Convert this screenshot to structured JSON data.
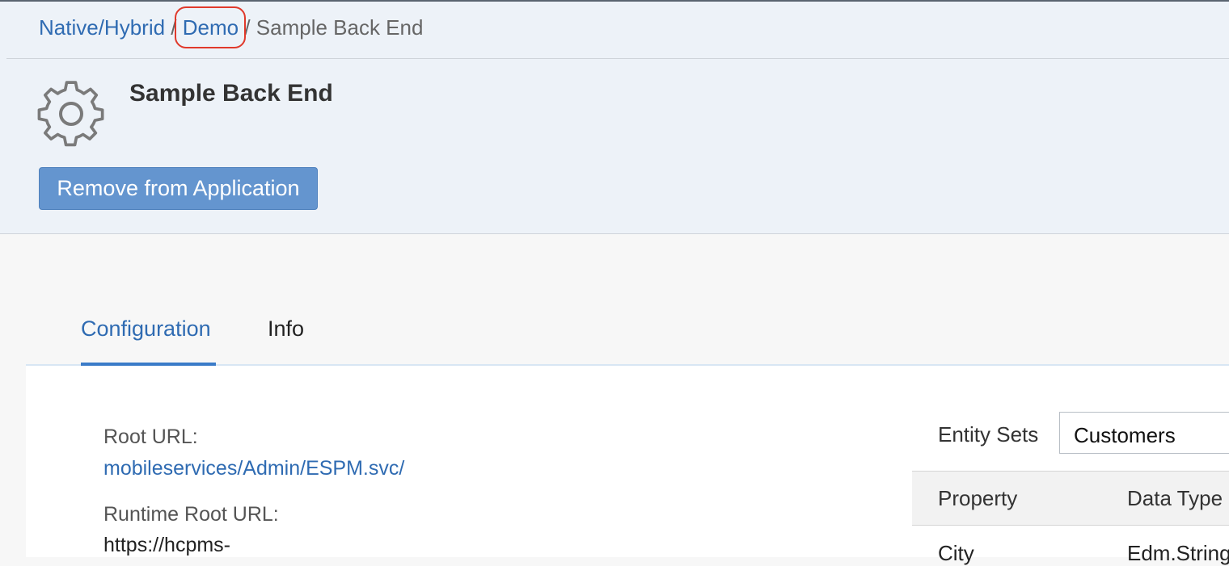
{
  "breadcrumb": {
    "items": [
      {
        "label": "Native/Hybrid"
      },
      {
        "label": "Demo"
      }
    ],
    "current": "Sample Back End",
    "separator": "/"
  },
  "header": {
    "title": "Sample Back End",
    "icon": "gear-icon",
    "remove_button": "Remove from Application"
  },
  "tabs": [
    {
      "label": "Configuration",
      "active": true
    },
    {
      "label": "Info",
      "active": false
    }
  ],
  "config": {
    "root_url_label": "Root URL:",
    "root_url_value": "mobileservices/Admin/ESPM.svc/",
    "runtime_root_url_label": "Runtime Root URL:",
    "runtime_root_url_value": "https://hcpms-"
  },
  "entity_sets": {
    "label": "Entity Sets",
    "selected": "Customers",
    "columns": [
      "Property",
      "Data Type"
    ],
    "rows": [
      {
        "property": "City",
        "data_type": "Edm.String"
      }
    ]
  },
  "colors": {
    "link": "#2f6bb2",
    "button": "#6495cf",
    "highlight": "#e0392b",
    "header_bg": "#edf2f8"
  }
}
